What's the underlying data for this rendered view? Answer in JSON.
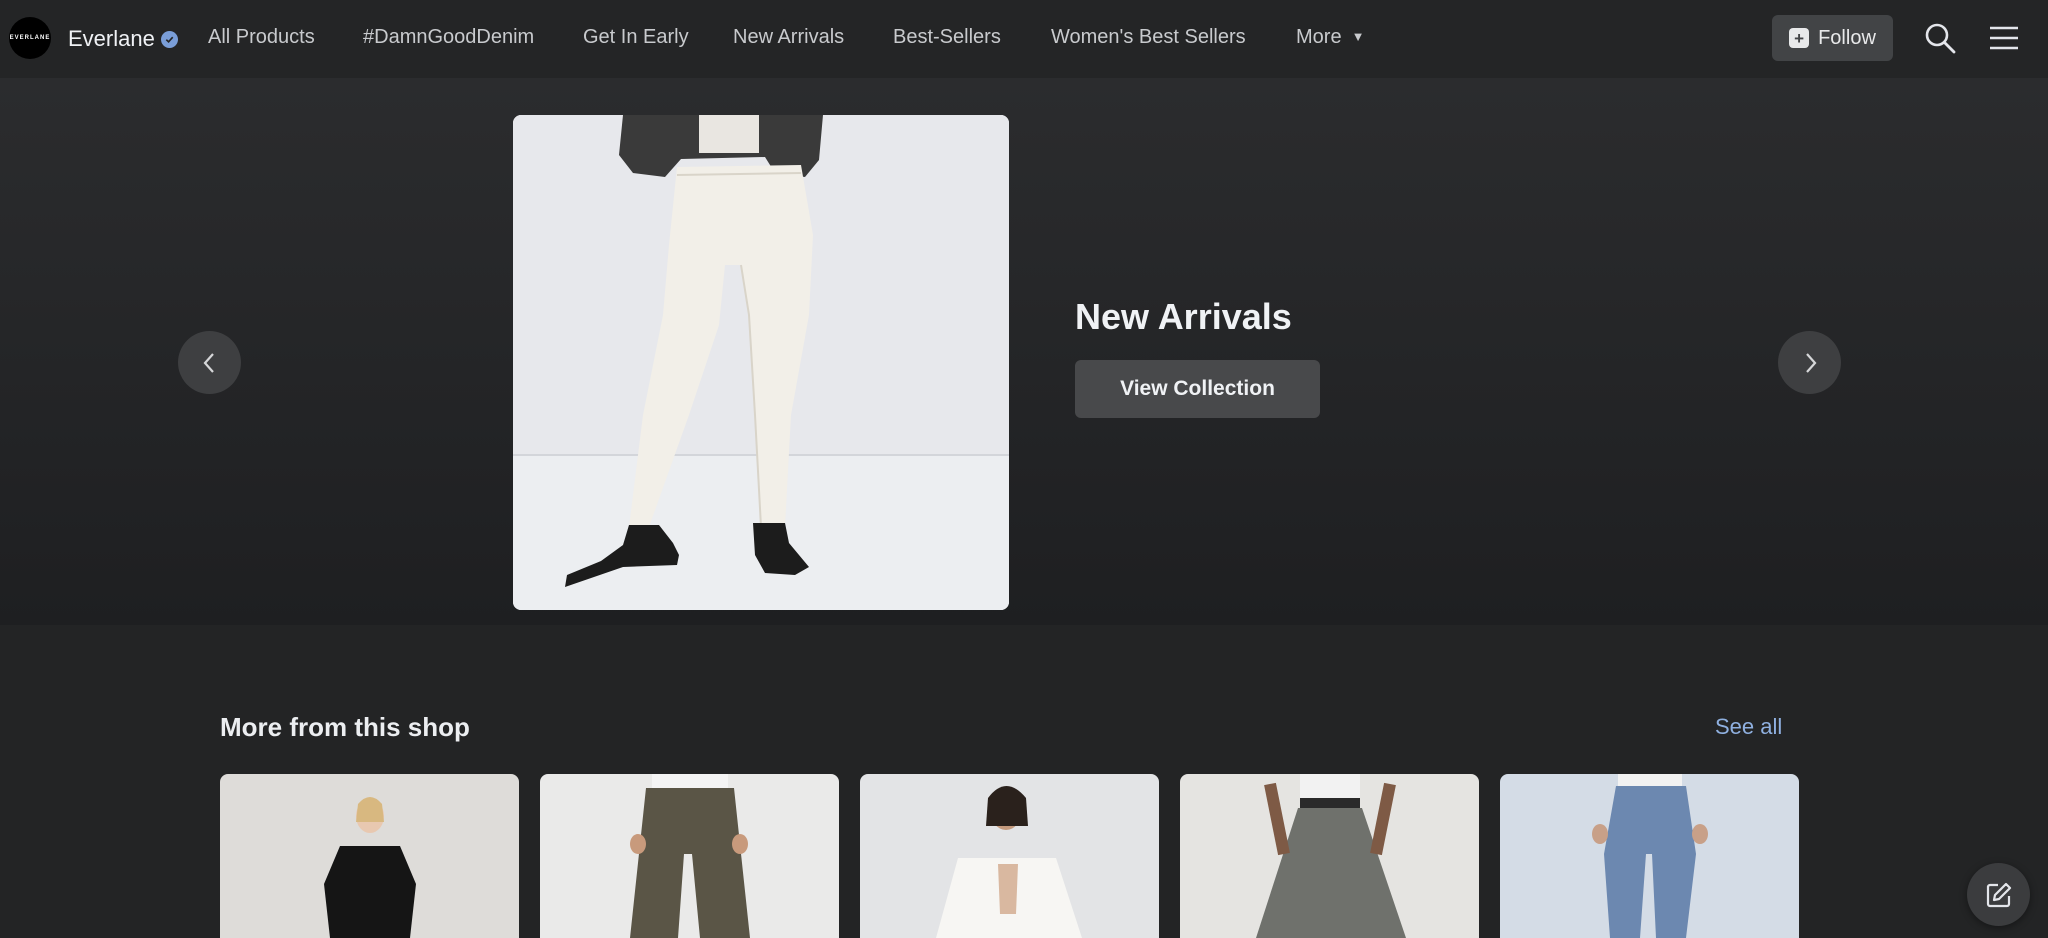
{
  "header": {
    "logo_text": "EVERLANE",
    "brand": "Everlane",
    "nav": [
      {
        "label": "All Products"
      },
      {
        "label": "#DamnGoodDenim"
      },
      {
        "label": "Get In Early"
      },
      {
        "label": "New Arrivals"
      },
      {
        "label": "Best-Sellers"
      },
      {
        "label": "Women's Best Sellers"
      },
      {
        "label": "More"
      }
    ],
    "follow_label": "Follow",
    "icons": [
      "search-icon",
      "menu-icon"
    ]
  },
  "hero": {
    "title": "New Arrivals",
    "button": "View Collection",
    "prev_icon": "chevron-left-icon",
    "next_icon": "chevron-right-icon"
  },
  "shop": {
    "title": "More from this shop",
    "see_all": "See all",
    "products": [
      {
        "alt": "model in black shirt dress"
      },
      {
        "alt": "model in brown wide-leg trousers"
      },
      {
        "alt": "model in white cropped jacket"
      },
      {
        "alt": "model in grey skirt"
      },
      {
        "alt": "model in blue jeans"
      }
    ]
  },
  "colors": {
    "background": "#232425",
    "header": "#242526",
    "button": "#48494b",
    "link": "#8fb0e0"
  }
}
